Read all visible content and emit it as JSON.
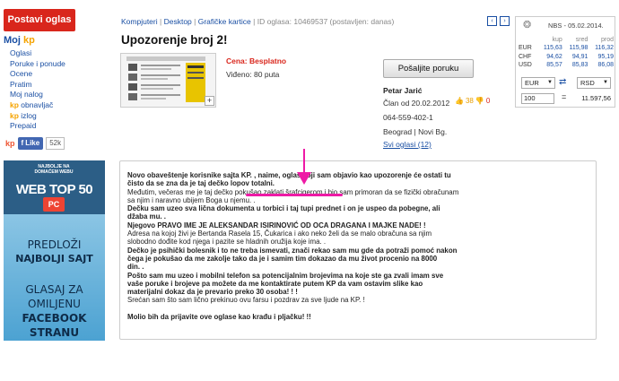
{
  "left": {
    "post_button": "Postavi oglas",
    "my_kp": {
      "prefix": "Moj ",
      "brand": "kp"
    },
    "menu": [
      {
        "label": "Oglasi"
      },
      {
        "label": "Poruke i ponude"
      },
      {
        "label": "Ocene"
      },
      {
        "label": "Pratim"
      },
      {
        "label": "Moj nalog"
      },
      {
        "kp": "kp",
        "label": " obnavljač"
      },
      {
        "kp": "kp",
        "label": " izlog"
      },
      {
        "label": "Prepaid"
      }
    ],
    "social": {
      "kp": "kp",
      "like": "Like",
      "count": "52k"
    },
    "banner": {
      "tagline": "NAJBOLJE NA DOMAĆEM WEBU",
      "title": "WEB TOP 50",
      "badge": "PC",
      "lines": [
        "PREDLOŽI",
        "NAJBOLJI SAJT",
        "GLASAJ ZA",
        "OMILJENU",
        "FACEBOOK",
        "STRANU"
      ]
    }
  },
  "breadcrumb": {
    "items": [
      "Kompjuteri",
      "Desktop",
      "Grafičke kartice"
    ],
    "meta": "ID oglasa: 10469537 (postavljen: danas)"
  },
  "pager": {
    "prev": "‹",
    "next": "›"
  },
  "ad": {
    "title": "Upozorenje broj 2!",
    "price_label": "Cena: ",
    "price_value": "Besplatno",
    "views": "Viđeno: 80 puta",
    "zoom": "+"
  },
  "seller": {
    "send_button": "Pošaljite poruku",
    "name": "Petar Jarić",
    "member_since": "Član od 20.02.2012",
    "votes_up": "38",
    "votes_down": "0",
    "phone": "064-559-402-1",
    "location": "Beograd | Novi Bg.",
    "all_ads": "Svi oglasi (12)"
  },
  "fx": {
    "header": "NBS - 05.02.2014.",
    "columns": [
      "",
      "kup",
      "sred",
      "prod"
    ],
    "rows": [
      {
        "cur": "EUR",
        "kup": "115,63",
        "sred": "115,98",
        "prod": "116,32"
      },
      {
        "cur": "CHF",
        "kup": "94,62",
        "sred": "94,91",
        "prod": "95,19"
      },
      {
        "cur": "USD",
        "kup": "85,57",
        "sred": "85,83",
        "prod": "86,08"
      }
    ],
    "from": "EUR",
    "to": "RSD",
    "amount": "100",
    "equals": "=",
    "result": "11.597,56"
  },
  "description": [
    {
      "t": "Novo obaveštenje korisnike sajta KP. , naime, oglas koji sam objavio kao upozorenje će ostati tu",
      "b": true
    },
    {
      "t": "čisto da se zna da je taj dečko lopov totalni.",
      "b": true
    },
    {
      "t": "Međutim, večeras me je taj dečko pokušao zaklati šrafcigerom i bio sam primoran da se fizički obračunam",
      "b": false
    },
    {
      "t": "sa njim i naravno ubijem Boga u njemu. .",
      "b": false
    },
    {
      "t": "Dečku sam uzeo sva lična dokumenta u torbici i taj tupi prednet i on je uspeo da pobegne, ali",
      "b": true
    },
    {
      "t": "džaba mu. .",
      "b": true
    },
    {
      "t": "Njegovo PRAVO IME JE ALEKSANDAR ISIRINOVIĆ OD OCA DRAGANA I MAJKE NADE! !",
      "b": true
    },
    {
      "t": "Adresa na kojoj živi je Bertanda Rasela 15, Čukarica i ako neko želi da se malo obračuna sa njim",
      "b": false
    },
    {
      "t": "slobodno dođite kod njega i pazite se hladnih oružija koje ima. .",
      "b": false
    },
    {
      "t": "Dečko je psihički bolesnik i to ne treba ismevati, znači rekao sam mu gde da potraži pomoć nakon",
      "b": true
    },
    {
      "t": "čega je pokušao da me zakolje tako da je i samim tim dokazao da mu život procenio na 8000",
      "b": true
    },
    {
      "t": "din. .",
      "b": true
    },
    {
      "t": "Pošto sam mu uzeo i mobilni telefon sa potencijalnim brojevima na koje ste ga zvali imam sve",
      "b": true
    },
    {
      "t": "vaše poruke i brojeve pa možete da me kontaktirate putem KP da vam ostavim slike kao",
      "b": true
    },
    {
      "t": "materijalni dokaz da je prevario preko 30 osoba! ! !",
      "b": true
    },
    {
      "t": "Srećan sam što sam lično prekinuo ovu farsu i pozdrav za sve ljude na KP. !",
      "b": false
    },
    {
      "t": "Molio bih da prijavite ove oglase kao krađu i pljačku! !!",
      "b": true,
      "gap": true
    }
  ]
}
